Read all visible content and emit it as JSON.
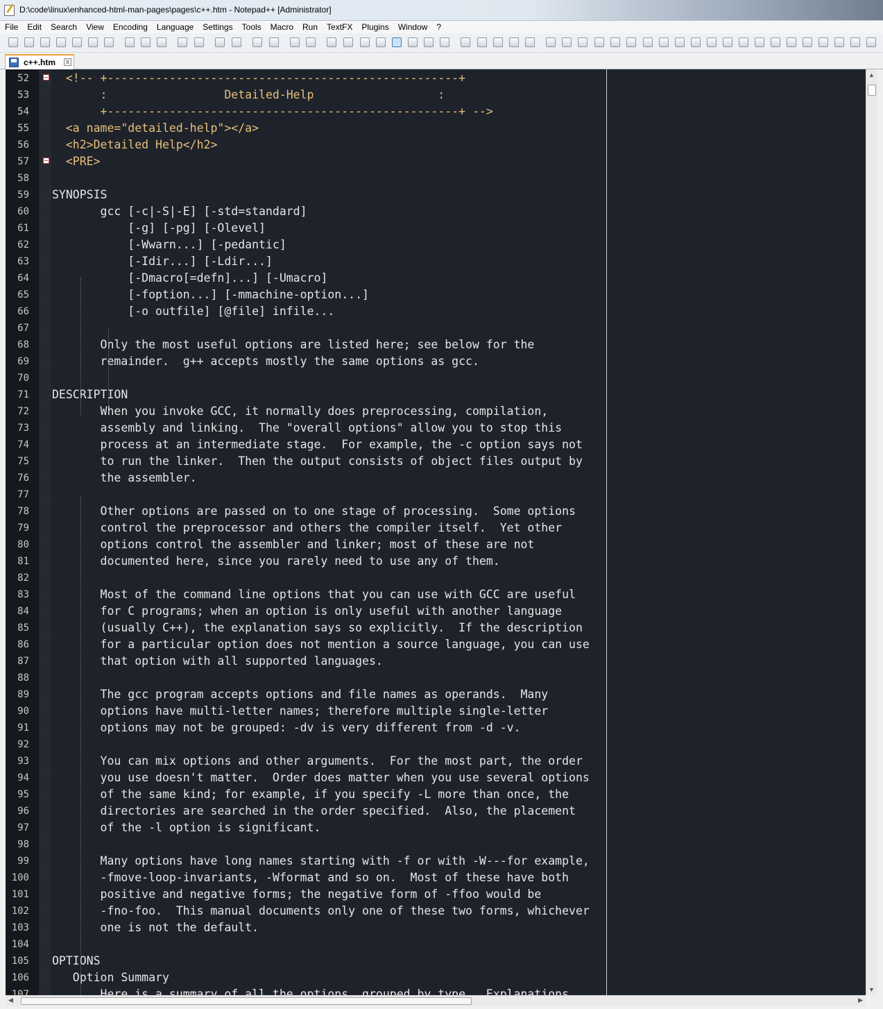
{
  "window": {
    "title": "D:\\code\\linux\\enhanced-html-man-pages\\pages\\c++.htm - Notepad++ [Administrator]"
  },
  "menu": [
    "File",
    "Edit",
    "Search",
    "View",
    "Encoding",
    "Language",
    "Settings",
    "Tools",
    "Macro",
    "Run",
    "TextFX",
    "Plugins",
    "Window",
    "?"
  ],
  "tab": {
    "label": "c++.htm",
    "close": "x"
  },
  "scroll": {
    "v_up": "▲",
    "v_down": "▼",
    "h_left": "◀",
    "h_right": "▶"
  },
  "lines": [
    {
      "n": "52",
      "text": "  <!-- +---------------------------------------------------+"
    },
    {
      "n": "53",
      "text": "       :                 Detailed-Help                  :"
    },
    {
      "n": "54",
      "text": "       +---------------------------------------------------+ -->"
    },
    {
      "n": "55",
      "text": "  <a name=\"detailed-help\"></a>"
    },
    {
      "n": "56",
      "text": "  <h2>Detailed Help</h2>"
    },
    {
      "n": "57",
      "text": "  <PRE>"
    },
    {
      "n": "58",
      "text": ""
    },
    {
      "n": "59",
      "text": "SYNOPSIS"
    },
    {
      "n": "60",
      "text": "       gcc [-c|-S|-E] [-std=standard]"
    },
    {
      "n": "61",
      "text": "           [-g] [-pg] [-Olevel]"
    },
    {
      "n": "62",
      "text": "           [-Wwarn...] [-pedantic]"
    },
    {
      "n": "63",
      "text": "           [-Idir...] [-Ldir...]"
    },
    {
      "n": "64",
      "text": "           [-Dmacro[=defn]...] [-Umacro]"
    },
    {
      "n": "65",
      "text": "           [-foption...] [-mmachine-option...]"
    },
    {
      "n": "66",
      "text": "           [-o outfile] [@file] infile..."
    },
    {
      "n": "67",
      "text": ""
    },
    {
      "n": "68",
      "text": "       Only the most useful options are listed here; see below for the"
    },
    {
      "n": "69",
      "text": "       remainder.  g++ accepts mostly the same options as gcc."
    },
    {
      "n": "70",
      "text": ""
    },
    {
      "n": "71",
      "text": "DESCRIPTION"
    },
    {
      "n": "72",
      "text": "       When you invoke GCC, it normally does preprocessing, compilation,"
    },
    {
      "n": "73",
      "text": "       assembly and linking.  The \"overall options\" allow you to stop this"
    },
    {
      "n": "74",
      "text": "       process at an intermediate stage.  For example, the -c option says not"
    },
    {
      "n": "75",
      "text": "       to run the linker.  Then the output consists of object files output by"
    },
    {
      "n": "76",
      "text": "       the assembler."
    },
    {
      "n": "77",
      "text": ""
    },
    {
      "n": "78",
      "text": "       Other options are passed on to one stage of processing.  Some options"
    },
    {
      "n": "79",
      "text": "       control the preprocessor and others the compiler itself.  Yet other"
    },
    {
      "n": "80",
      "text": "       options control the assembler and linker; most of these are not"
    },
    {
      "n": "81",
      "text": "       documented here, since you rarely need to use any of them."
    },
    {
      "n": "82",
      "text": ""
    },
    {
      "n": "83",
      "text": "       Most of the command line options that you can use with GCC are useful"
    },
    {
      "n": "84",
      "text": "       for C programs; when an option is only useful with another language"
    },
    {
      "n": "85",
      "text": "       (usually C++), the explanation says so explicitly.  If the description"
    },
    {
      "n": "86",
      "text": "       for a particular option does not mention a source language, you can use"
    },
    {
      "n": "87",
      "text": "       that option with all supported languages."
    },
    {
      "n": "88",
      "text": ""
    },
    {
      "n": "89",
      "text": "       The gcc program accepts options and file names as operands.  Many"
    },
    {
      "n": "90",
      "text": "       options have multi-letter names; therefore multiple single-letter"
    },
    {
      "n": "91",
      "text": "       options may not be grouped: -dv is very different from -d -v."
    },
    {
      "n": "92",
      "text": ""
    },
    {
      "n": "93",
      "text": "       You can mix options and other arguments.  For the most part, the order"
    },
    {
      "n": "94",
      "text": "       you use doesn't matter.  Order does matter when you use several options"
    },
    {
      "n": "95",
      "text": "       of the same kind; for example, if you specify -L more than once, the"
    },
    {
      "n": "96",
      "text": "       directories are searched in the order specified.  Also, the placement"
    },
    {
      "n": "97",
      "text": "       of the -l option is significant."
    },
    {
      "n": "98",
      "text": ""
    },
    {
      "n": "99",
      "text": "       Many options have long names starting with -f or with -W---for example,"
    },
    {
      "n": "100",
      "text": "       -fmove-loop-invariants, -Wformat and so on.  Most of these have both"
    },
    {
      "n": "101",
      "text": "       positive and negative forms; the negative form of -ffoo would be"
    },
    {
      "n": "102",
      "text": "       -fno-foo.  This manual documents only one of these two forms, whichever"
    },
    {
      "n": "103",
      "text": "       one is not the default."
    },
    {
      "n": "104",
      "text": ""
    },
    {
      "n": "105",
      "text": "OPTIONS"
    },
    {
      "n": "106",
      "text": "   Option Summary"
    },
    {
      "n": "107",
      "text": "       Here is a summary of all the options, grouped by type.  Explanations"
    }
  ]
}
